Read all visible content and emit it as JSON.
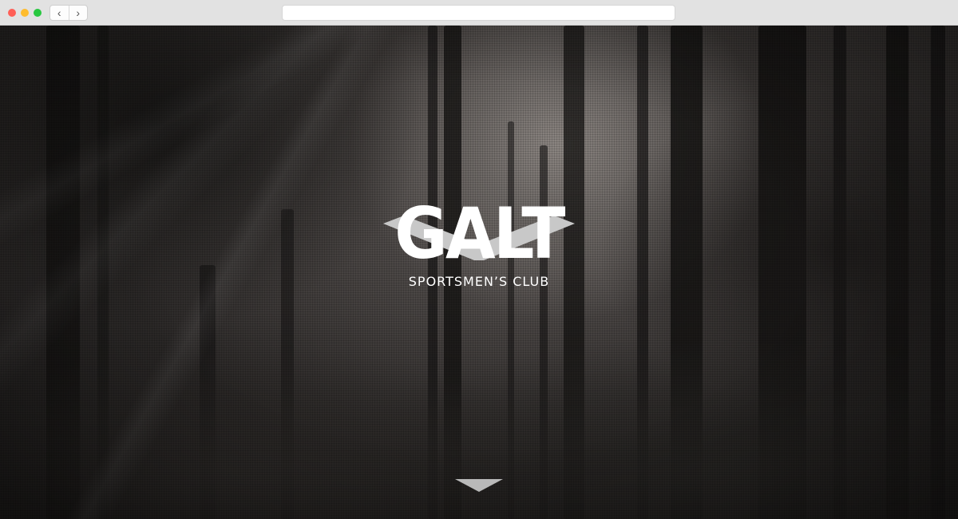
{
  "browser": {
    "back_icon": "chevron-left-icon",
    "forward_icon": "chevron-right-icon",
    "back_glyph": "‹",
    "forward_glyph": "›",
    "url": ""
  },
  "hero": {
    "logo_word": "GALT",
    "logo_subtitle": "SPORTSMEN’S CLUB",
    "logo_band_color": "#c8c8c8",
    "text_color": "#ffffff",
    "scroll_icon": "triangle-down-icon",
    "scroll_color": "#b9b9b9"
  }
}
